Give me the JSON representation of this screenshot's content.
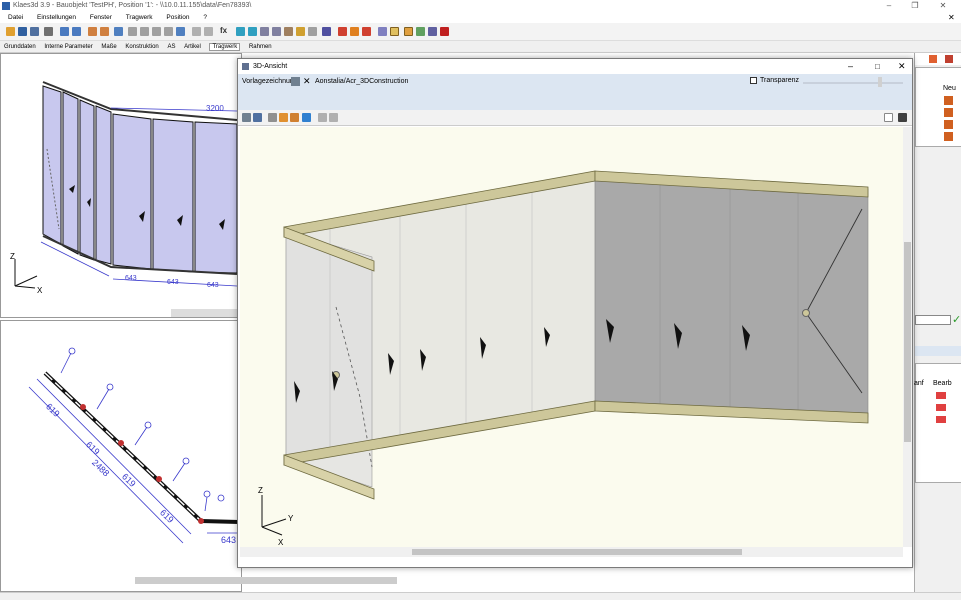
{
  "window": {
    "title": "Klaes3d 3.9 - Bauobjekt 'TestPH', Position '1':  - \\\\10.0.11.155\\data\\Fen78393\\"
  },
  "menu": [
    "Datei",
    "Einstellungen",
    "Fenster",
    "Tragwerk",
    "Position",
    "?"
  ],
  "ribbon": {
    "tabs": [
      "Grunddaten",
      "Interne Parameter",
      "Maße",
      "Konstruktion",
      "AS",
      "Artikel",
      "Tragwerk",
      "Rahmen"
    ],
    "active": "Tragwerk"
  },
  "top_drawing": {
    "dim_top": "3200",
    "dims_bottom": [
      "643",
      "643",
      "643"
    ]
  },
  "bottom_drawing": {
    "dims": [
      "619",
      "619",
      "619",
      "619",
      "2488"
    ],
    "dim_end": "643"
  },
  "axes": {
    "x": "X",
    "y": "Y",
    "z": "Z"
  },
  "right_panel": {
    "col_neu": "Neu",
    "col_bearb": "Bearb",
    "col_anf": "anf"
  },
  "dialog": {
    "title": "3D-Ansicht",
    "vorlage_label": "Vorlagezeichnung:",
    "vorlage_value": "Aonstalia/Acr_3DConstruction",
    "transparenz_label": "Transparenz",
    "transparenz_checked": false
  },
  "colors": {
    "accent": "#0078d7",
    "frame": "#cdc79a",
    "glass": "#d6d6d6",
    "bg3d": "#fbfbee",
    "panel_blue": "#c8c8ee",
    "dim_blue": "#3a3acc"
  }
}
